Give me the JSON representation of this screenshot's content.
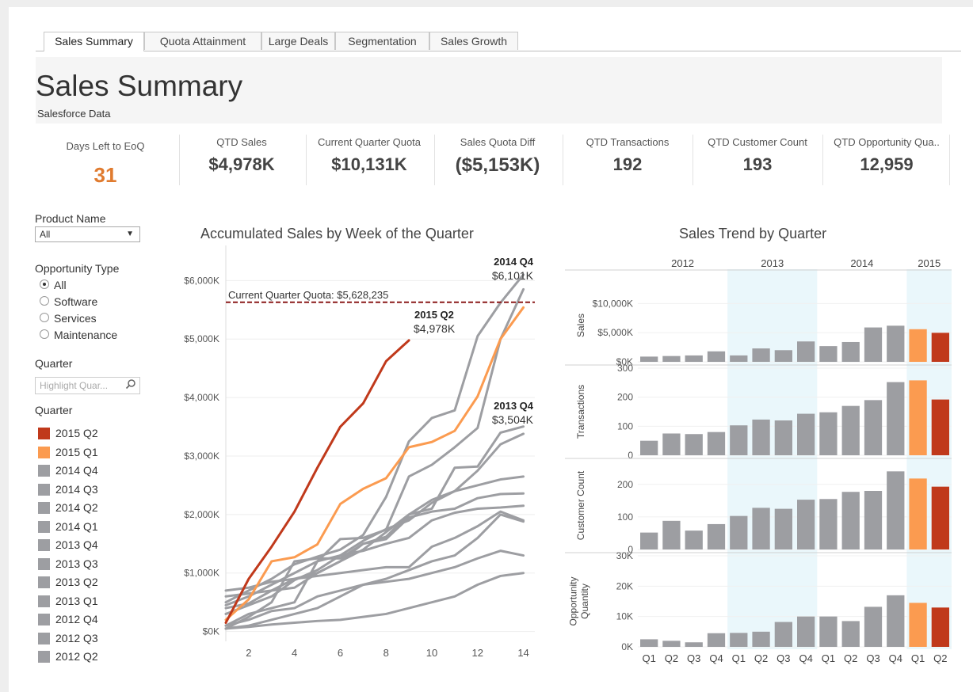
{
  "tabs": [
    "Sales Summary",
    "Quota Attainment",
    "Large Deals",
    "Segmentation",
    "Sales Growth"
  ],
  "header": {
    "title": "Sales Summary",
    "subtitle": "Salesforce Data"
  },
  "kpis": [
    {
      "label": "Days Left to EoQ",
      "value": "31"
    },
    {
      "label": "QTD Sales",
      "value": "$4,978K"
    },
    {
      "label": "Current Quarter Quota",
      "value": "$10,131K"
    },
    {
      "label": "Sales Quota Diff",
      "value": "($5,153K)"
    },
    {
      "label": "QTD Transactions",
      "value": "192"
    },
    {
      "label": "QTD Customer Count",
      "value": "193"
    },
    {
      "label": "QTD Opportunity Qua..",
      "value": "12,959"
    }
  ],
  "filters": {
    "product": {
      "title": "Product Name",
      "value": "All"
    },
    "opportunity": {
      "title": "Opportunity Type",
      "options": [
        "All",
        "Software",
        "Services",
        "Maintenance"
      ],
      "selected": "All"
    },
    "quarter_search": {
      "title": "Quarter",
      "placeholder": "Highlight Quar..."
    },
    "quarter_legend": {
      "title": "Quarter",
      "items": [
        "2015 Q2",
        "2015 Q1",
        "2014 Q4",
        "2014 Q3",
        "2014 Q2",
        "2014 Q1",
        "2013 Q4",
        "2013 Q3",
        "2013 Q2",
        "2013 Q1",
        "2012 Q4",
        "2012 Q3",
        "2012 Q2"
      ]
    }
  },
  "colors": {
    "current": "#c0391b",
    "previous": "#fb9b50",
    "other": "#9d9ea2",
    "quota_line": "#8b1a1a",
    "band": "#eaf7fb",
    "accent_orange": "#e07b2f"
  },
  "chart_data": [
    {
      "type": "line",
      "title": "Accumulated Sales by Week of the Quarter",
      "xlabel": "",
      "ylabel": "",
      "x_ticks": [
        2,
        4,
        6,
        8,
        10,
        12,
        14
      ],
      "y_ticks": [
        "$0K",
        "$1,000K",
        "$2,000K",
        "$3,000K",
        "$4,000K",
        "$5,000K",
        "$6,000K"
      ],
      "xlim": [
        1,
        14.5
      ],
      "ylim": [
        -100,
        6600
      ],
      "quota": {
        "value": 5628,
        "label": "Current Quarter Quota: $5,628,235"
      },
      "annotations": [
        {
          "title": "2014 Q4",
          "value": "$6,101K"
        },
        {
          "title": "2015 Q2",
          "value": "$4,978K"
        },
        {
          "title": "2013 Q4",
          "value": "$3,504K"
        }
      ],
      "series": [
        {
          "name": "2015 Q2",
          "role": "current",
          "values": [
            150,
            900,
            1450,
            2050,
            2800,
            3500,
            3900,
            4620,
            4978
          ]
        },
        {
          "name": "2015 Q1",
          "role": "previous",
          "values": [
            200,
            550,
            1200,
            1270,
            1490,
            2180,
            2440,
            2620,
            3150,
            3240,
            3430,
            4020,
            5000,
            5540
          ]
        },
        {
          "name": "2014 Q4",
          "role": "other",
          "values": [
            500,
            700,
            900,
            1150,
            1280,
            1400,
            1650,
            2300,
            3250,
            3650,
            3780,
            5050,
            5620,
            6101
          ]
        },
        {
          "name": "2014 Q3",
          "role": "other",
          "values": [
            450,
            600,
            800,
            1000,
            1200,
            1580,
            1600,
            1740,
            2650,
            2850,
            3150,
            3480,
            5000,
            5850
          ]
        },
        {
          "name": "2014 Q2",
          "role": "other",
          "values": [
            400,
            480,
            700,
            900,
            1000,
            1200,
            1400,
            1700,
            2000,
            2100,
            2800,
            2820,
            3400,
            3504
          ]
        },
        {
          "name": "2014 Q1",
          "role": "other",
          "values": [
            300,
            450,
            600,
            880,
            1050,
            1300,
            1550,
            1750,
            1900,
            2200,
            2400,
            2750,
            3200,
            3380
          ]
        },
        {
          "name": "2013 Q4",
          "role": "other",
          "values": [
            600,
            650,
            700,
            750,
            1000,
            1200,
            1500,
            1620,
            2000,
            2250,
            2400,
            2500,
            2600,
            2650
          ]
        },
        {
          "name": "2013 Q3",
          "role": "other",
          "values": [
            50,
            250,
            500,
            1200,
            1250,
            1250,
            1500,
            1580,
            1950,
            2050,
            2100,
            2280,
            2350,
            2360
          ]
        },
        {
          "name": "2013 Q2",
          "role": "other",
          "values": [
            100,
            300,
            400,
            500,
            1200,
            1300,
            1380,
            1500,
            1600,
            1900,
            2030,
            2100,
            2120,
            2150
          ]
        },
        {
          "name": "2013 Q1",
          "role": "other",
          "values": [
            700,
            750,
            850,
            900,
            950,
            1000,
            1050,
            1100,
            1100,
            1450,
            1600,
            1800,
            2050,
            1900
          ]
        },
        {
          "name": "2012 Q4",
          "role": "other",
          "values": [
            100,
            200,
            350,
            400,
            600,
            700,
            800,
            900,
            1050,
            1200,
            1300,
            1600,
            2000,
            1880
          ]
        },
        {
          "name": "2012 Q3",
          "role": "other",
          "values": [
            50,
            100,
            200,
            300,
            400,
            600,
            800,
            850,
            900,
            1000,
            1100,
            1250,
            1380,
            1300
          ]
        },
        {
          "name": "2012 Q2",
          "role": "other",
          "values": [
            50,
            80,
            120,
            150,
            180,
            200,
            250,
            300,
            400,
            500,
            600,
            800,
            950,
            1000
          ]
        }
      ]
    },
    {
      "type": "bar",
      "title": "Sales Trend by Quarter",
      "years": [
        "2012",
        "2013",
        "2014",
        "2015"
      ],
      "categories": [
        "Q1",
        "Q2",
        "Q3",
        "Q4",
        "Q1",
        "Q2",
        "Q3",
        "Q4",
        "Q1",
        "Q2",
        "Q3",
        "Q4",
        "Q1",
        "Q2"
      ],
      "roles": [
        "o",
        "o",
        "o",
        "o",
        "o",
        "o",
        "o",
        "o",
        "o",
        "o",
        "o",
        "o",
        "p",
        "c"
      ],
      "panels": [
        {
          "ylabel": "Sales",
          "yticks": [
            "$0K",
            "$5,000K",
            "$10,000K"
          ],
          "tick_values": [
            0,
            5000,
            10000
          ],
          "ymax": 12500,
          "values": [
            900,
            1000,
            1100,
            1800,
            1100,
            2300,
            2000,
            3500,
            2700,
            3400,
            5900,
            6200,
            5600,
            4978
          ]
        },
        {
          "ylabel": "Transactions",
          "yticks": [
            "0",
            "100",
            "200",
            "300"
          ],
          "tick_values": [
            0,
            100,
            200,
            300
          ],
          "ymax": 300,
          "values": [
            50,
            75,
            73,
            80,
            103,
            123,
            120,
            143,
            148,
            170,
            190,
            252,
            258,
            192
          ]
        },
        {
          "ylabel": "Customer Count",
          "yticks": [
            "0",
            "100",
            "200"
          ],
          "tick_values": [
            0,
            100,
            200
          ],
          "ymax": 270,
          "values": [
            52,
            88,
            58,
            78,
            103,
            128,
            125,
            153,
            155,
            177,
            180,
            240,
            218,
            193
          ]
        },
        {
          "ylabel": "Opportunity Quantity",
          "yticks": [
            "0K",
            "10K",
            "20K",
            "30K"
          ],
          "tick_values": [
            0,
            10000,
            20000,
            30000
          ],
          "ymax": 30000,
          "values": [
            2500,
            2000,
            1500,
            4500,
            4600,
            5000,
            8200,
            10000,
            10000,
            8500,
            13200,
            17000,
            14500,
            12959
          ]
        }
      ]
    }
  ]
}
